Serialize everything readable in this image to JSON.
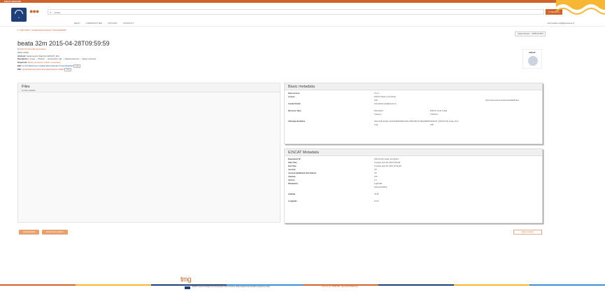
{
  "topbar": {
    "text": "EISCAT B2SHARE"
  },
  "search": {
    "placeholder": "eiscat",
    "button": "Q SEARCH"
  },
  "nav": {
    "items": [
      "HELP",
      "COMMUNITIES",
      "UPLOAD",
      "CONTACT"
    ]
  },
  "user": {
    "label": "carl-fredrik.enell@eiscat.se ▾"
  },
  "breadcrumb": "✦ / RECORDS / b1a38a72b1dc4b3e9e7173e2195ab695",
  "version": "Latest Version - 2015-04-28 ▾",
  "record": {
    "title": "beata 32m 2015-04-28T09:59:59",
    "by_label": "by",
    "by": "EISCAT Scientific Association",
    "date": "2015-4-2016",
    "abstract_label": "Abstract:",
    "abstract": "beata Level 2 data from EISCAT_32m",
    "disciplines_label": "Disciplines:",
    "disciplines": "[ Local → Physics → Geophysics, p[]] → Natural sciences → Space sciences",
    "keywords_label": "Keywords:",
    "keywords": "Beata, incoherent scatter, ionosphere",
    "doi_label": "DOI:",
    "doi": "10.23728/b2share.b1a38a72b1dc4b3e9e7173e2195ab695",
    "pid_label": "PID:",
    "pid": "11304/1fb6ae0b-b8e0-4b2f-a8e8-4b9e6e7d28b0",
    "copy": "Copy"
  },
  "community": {
    "label": "EISCAT"
  },
  "files": {
    "title": "Files",
    "subtitle": "No files available."
  },
  "basic": {
    "title": "Basic metadata",
    "rows": [
      {
        "k": "Open Access",
        "v": "True ✔",
        "v2": "",
        "v3": ""
      },
      {
        "k": "License",
        "v": "EISCAT Rules of the Road",
        "v2": "",
        "v3": ""
      },
      {
        "k": "",
        "v": "URL",
        "v2": "",
        "v3": "https://www.eiscat.se/scientist/data/#rules"
      },
      {
        "k": "Contact Email",
        "v": "carl-fredrik.enell@eiscat.se",
        "v2": "",
        "v3": ""
      },
      {
        "k": "",
        "v": "",
        "v2": "",
        "v3": ""
      },
      {
        "k": "Resource Type",
        "v": "Description",
        "v2": "",
        "v3": "EISCAT Level 2 data"
      },
      {
        "k": "",
        "v": "Category",
        "v2": "",
        "v3": "Collection"
      },
      {
        "k": "",
        "v": "",
        "v2": "",
        "v3": ""
      },
      {
        "k": "Alternate identifiers",
        "v": "https://hdl.handle.net/11304/09aaf4f0-5d4c-42f9-b9d3-d7c8ea48a893 (EISCAT_2015-04-28_beata_32m)",
        "v2": "",
        "v3": ""
      },
      {
        "k": "",
        "v": "Type",
        "v2": "",
        "v3": "URL"
      }
    ]
  },
  "eiscat": {
    "title": "EISCAT Metadata",
    "rows": [
      {
        "k": "Experiment ID",
        "v": "2015-04-28_beata_32m@32m"
      },
      {
        "k": "Start Time",
        "v": "Tuesday, April 28, 2015 9:59 AM"
      },
      {
        "k": "End Time",
        "v": "Tuesday, April 28, 2015 10:59 AM"
      },
      {
        "k": "Account",
        "v": "CP"
      },
      {
        "k": "Account (additional information)",
        "v": "CP"
      },
      {
        "k": "Antenna",
        "v": "32m"
      },
      {
        "k": "Version",
        "v": "1.0"
      },
      {
        "k": "Parameters",
        "v": "LagProfile"
      },
      {
        "k": "",
        "v": "ParameterBlock"
      },
      {
        "k": "Latitude",
        "v": "78.15"
      },
      {
        "k": "Longitude",
        "v": "16.02"
      }
    ]
  },
  "buttons": {
    "add_metadata": "Add Metadata",
    "create_version": "Create New Version",
    "report": "Report Abuse"
  },
  "footer": {
    "brand": "trng",
    "funding": "EUDAT receives funding from the European Union's Horizon 2020 research and innovation programme under",
    "links": "Terms of use · B2SHARE · Report B2SHARE Issue"
  },
  "colors": {
    "accent": "#d0632a",
    "brand": "#1e3f7a"
  }
}
